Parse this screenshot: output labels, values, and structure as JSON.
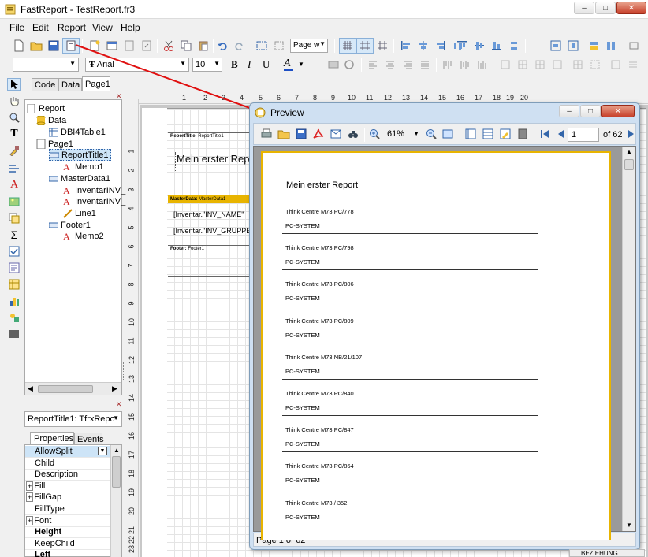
{
  "window": {
    "title": "FastReport - TestReport.fr3",
    "min": "–",
    "max": "□",
    "close": "✕"
  },
  "menu": [
    "File",
    "Edit",
    "Report",
    "View",
    "Help"
  ],
  "toolbar": {
    "page_width": "Page w",
    "font_name": "Arial",
    "font_size": "10",
    "style_b": "B",
    "style_i": "I",
    "style_u": "U",
    "style_a": "A"
  },
  "tabs": [
    "Code",
    "Data",
    "Page1"
  ],
  "tree": {
    "items": [
      {
        "label": "Report"
      },
      {
        "label": "Data"
      },
      {
        "label": "DBI4Table1"
      },
      {
        "label": "Page1"
      },
      {
        "label": "ReportTitle1"
      },
      {
        "label": "Memo1"
      },
      {
        "label": "MasterData1"
      },
      {
        "label": "InventarINV_"
      },
      {
        "label": "InventarINV_"
      },
      {
        "label": "Line1"
      },
      {
        "label": "Footer1"
      },
      {
        "label": "Memo2"
      }
    ]
  },
  "object_selector": "ReportTitle1: TfrxRepo",
  "prop_tabs": [
    "Properties",
    "Events"
  ],
  "properties": [
    "AllowSplit",
    "Child",
    "Description",
    "Fill",
    "FillGap",
    "FillType",
    "Font",
    "Height",
    "KeepChild",
    "Left"
  ],
  "ruler": {
    "numbers": [
      "1",
      "2",
      "3",
      "4",
      "5",
      "6",
      "7",
      "8",
      "9",
      "10",
      "11",
      "12",
      "13",
      "14",
      "15",
      "16",
      "17",
      "18",
      "19",
      "20"
    ],
    "vnumbers": [
      "1",
      "2",
      "3",
      "4",
      "5",
      "6",
      "7",
      "8",
      "9",
      "10",
      "11",
      "12",
      "13",
      "14",
      "15",
      "16",
      "17",
      "18",
      "19",
      "20",
      "21",
      "22",
      "23"
    ]
  },
  "bands": {
    "title_label": "ReportTitle:",
    "title_name": "ReportTitle1",
    "title_text": "Mein erster Repo",
    "master_label": "MasterData:",
    "master_name": "MasterData1",
    "field1": "[Inventar.\"INV_NAME\"",
    "field2": "[Inventar.\"INV_GRUPPE",
    "footer_label": "Footer:",
    "footer_name": "Footer1"
  },
  "preview": {
    "title": "Preview",
    "zoom": "61%",
    "page": "1",
    "of": "of 62",
    "status": "Page 1 of 62",
    "report_title": "Mein erster Report",
    "entries": [
      {
        "name": "Think Centre M73 PC/778",
        "group": "PC-SYSTEM"
      },
      {
        "name": "Think Centre M73 PC/798",
        "group": "PC-SYSTEM"
      },
      {
        "name": "Think Centre M73 PC/806",
        "group": "PC-SYSTEM"
      },
      {
        "name": "Think Centre M73 PC/809",
        "group": "PC-SYSTEM"
      },
      {
        "name": "Think Centre M73 NB/21/107",
        "group": "PC-SYSTEM"
      },
      {
        "name": "Think Centre M73 PC/840",
        "group": "PC-SYSTEM"
      },
      {
        "name": "Think Centre M73 PC/847",
        "group": "PC-SYSTEM"
      },
      {
        "name": "Think Centre M73 PC/864",
        "group": "PC-SYSTEM"
      },
      {
        "name": "Think Centre M73 / 352",
        "group": "PC-SYSTEM"
      }
    ]
  },
  "bottom_right_text": "BEZIEHUNG",
  "colors": {
    "accent": "#e8b400",
    "arrow": "#e01010",
    "selection": "#cde4f7"
  }
}
